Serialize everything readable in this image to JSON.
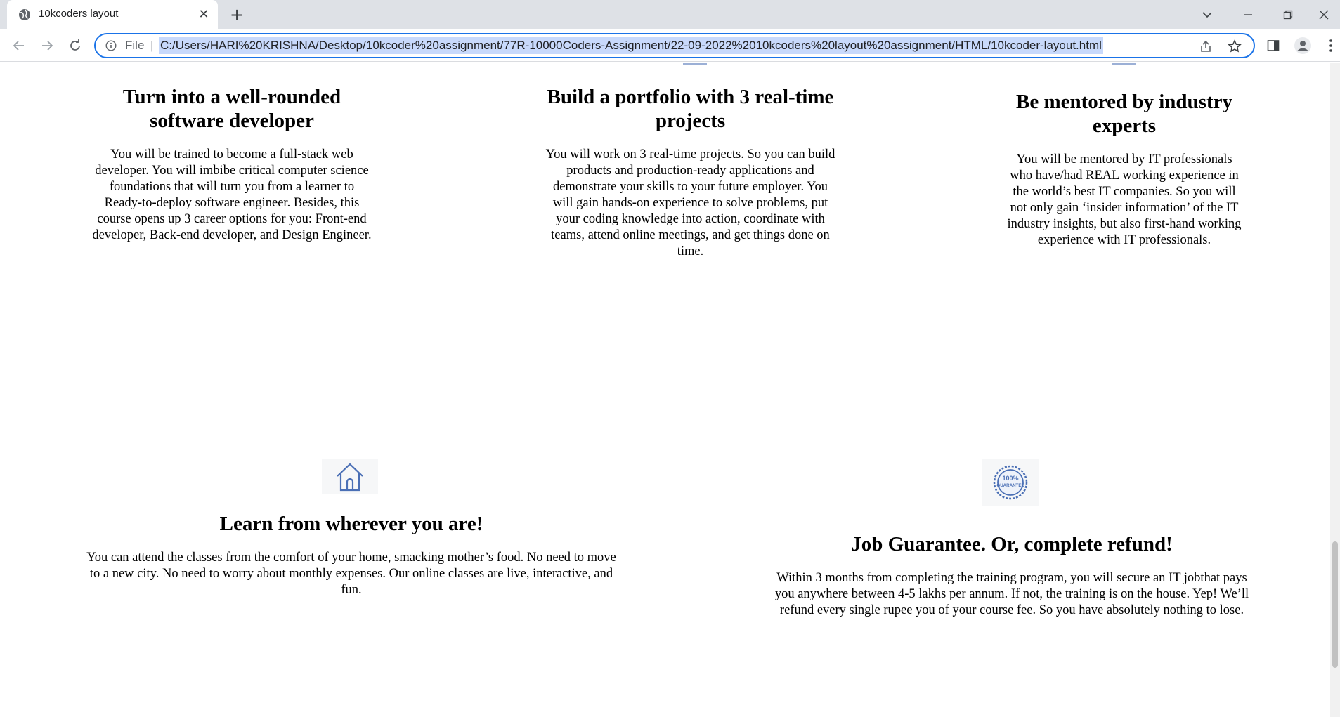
{
  "tab": {
    "title": "10kcoders layout"
  },
  "omnibox": {
    "scheme_chip": "File",
    "url": "C:/Users/HARI%20KRISHNA/Desktop/10kcoder%20assignment/77R-10000Coders-Assignment/22-09-2022%2010kcoders%20layout%20assignment/HTML/10kcoder-layout.html"
  },
  "features": [
    {
      "title": "Turn into a well-rounded software developer",
      "body": "You will be trained to become a full-stack web developer. You will imbibe critical computer science foundations that will turn you from a learner to Ready-to-deploy software engineer. Besides, this course opens up 3 career options for you: Front-end developer, Back-end developer, and Design Engineer."
    },
    {
      "title": "Build a portfolio with 3 real-time projects",
      "body": "You will work on 3 real-time projects. So you can build products and production-ready applications and demonstrate your skills to your future employer. You will gain hands-on experience to solve problems, put your coding knowledge into action, coordinate with teams, attend online meetings, and get things done on time."
    },
    {
      "title": "Be mentored by industry experts",
      "body": "You will be mentored by IT professionals who have/had REAL working experience in the world’s best IT companies. So you will not only gain ‘insider information’ of the IT industry insights, but also first-hand working experience with IT professionals."
    },
    {
      "title": "Learn from wherever you are!",
      "body": "You can attend the classes from the comfort of your home, smacking mother’s food. No need to move to a new city. No need to worry about monthly expenses. Our online classes are live, interactive, and fun."
    },
    {
      "title": "Job Guarantee. Or, complete refund!",
      "body": "Within 3 months from completing the training program, you will secure an IT jobthat pays you anywhere between 4-5 lakhs per annum. If not, the training is on the house. Yep! We’ll refund every single rupee you of your course fee. So you have absolutely nothing to lose.",
      "badge_text": "100% GUARANTEE"
    }
  ],
  "colors": {
    "accent": "#1a73e8",
    "icon_blue": "#4a6fb5",
    "tabstrip": "#dee1e6"
  },
  "icons": [
    "globe-icon",
    "close-icon",
    "plus-icon",
    "chevron-down-icon",
    "minimize-icon",
    "maximize-icon",
    "back-arrow-icon",
    "forward-arrow-icon",
    "reload-icon",
    "info-icon",
    "share-icon",
    "star-icon",
    "side-panel-icon",
    "profile-icon",
    "menu-icon",
    "home-icon",
    "guarantee-badge-icon"
  ]
}
